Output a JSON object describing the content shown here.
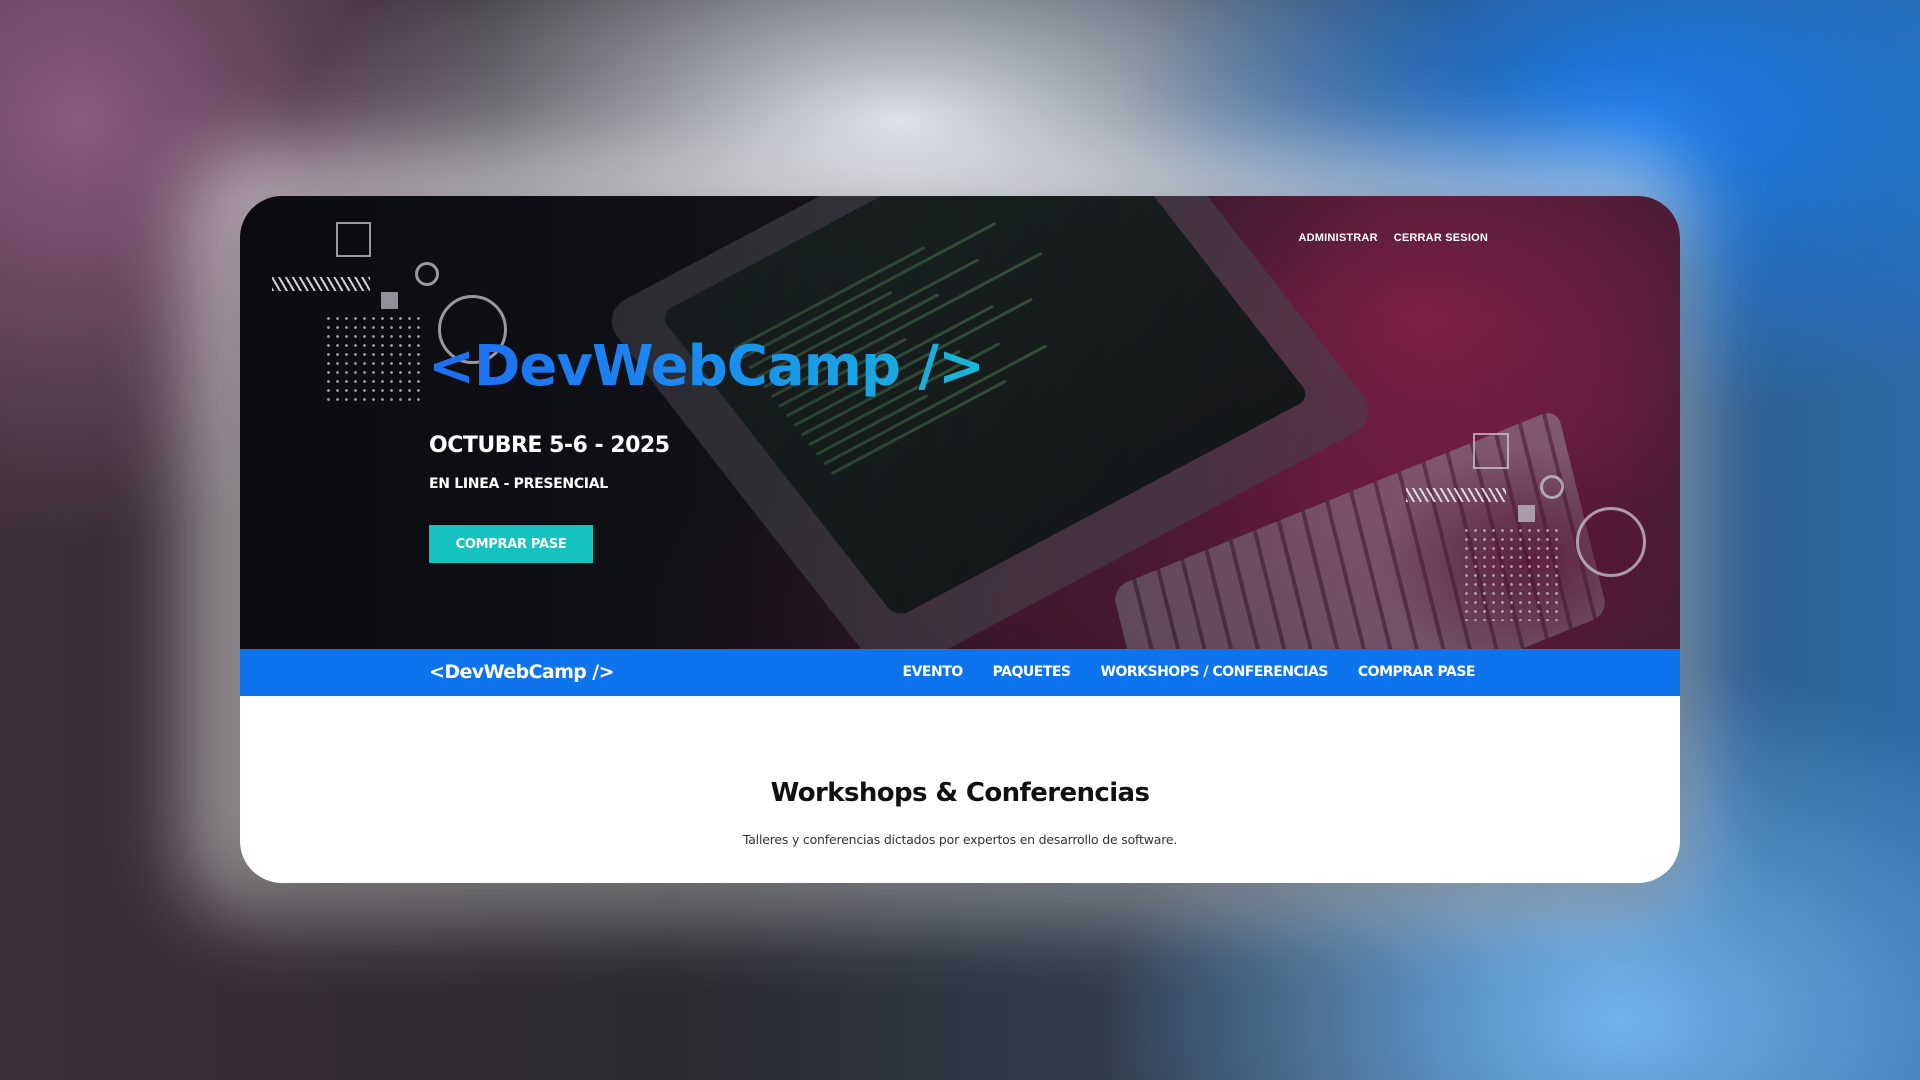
{
  "hero": {
    "top_links": {
      "admin": "ADMINISTRAR",
      "logout": "CERRAR SESION"
    },
    "logo": "<DevWebCamp />",
    "date": "OCTUBRE 5-6 - 2025",
    "mode": "EN LINEA - PRESENCIAL",
    "cta": "COMPRAR PASE"
  },
  "navbar": {
    "logo": "<DevWebCamp />",
    "links": [
      "EVENTO",
      "PAQUETES",
      "WORKSHOPS / CONFERENCIAS",
      "COMPRAR PASE"
    ]
  },
  "main": {
    "title": "Workshops & Conferencias",
    "subtitle": "Talleres y conferencias dictados por expertos en desarrollo de software."
  },
  "colors": {
    "nav_blue": "#0d74ee",
    "cta_teal": "#16c2c0",
    "logo_gradient_start": "#1e6cf2",
    "logo_gradient_end": "#19b7d6"
  }
}
